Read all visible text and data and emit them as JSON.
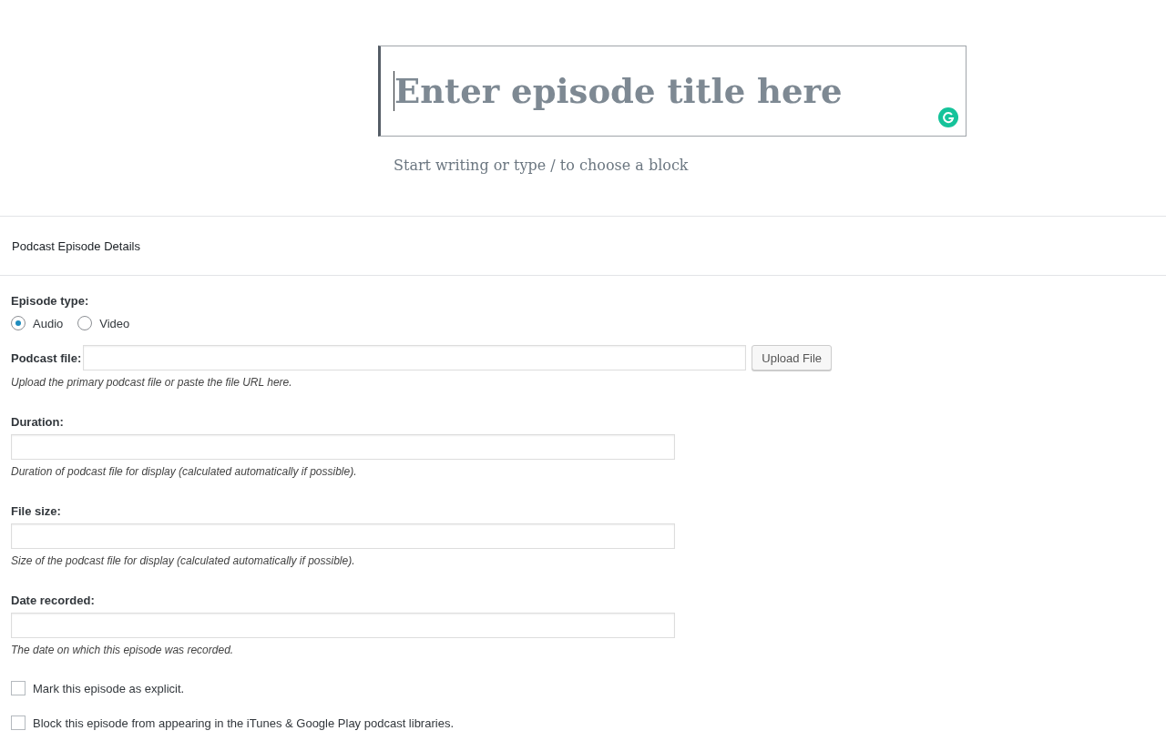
{
  "editor": {
    "title_placeholder": "Enter episode title here",
    "block_hint": "Start writing or type / to choose a block"
  },
  "panel": {
    "title": "Podcast Episode Details",
    "fields": [
      {
        "kind": "radio",
        "label": "Episode type:",
        "options": [
          {
            "label": "Audio",
            "selected": true
          },
          {
            "label": "Video",
            "selected": false
          }
        ]
      },
      {
        "kind": "file",
        "label": "Podcast file:",
        "button": "Upload File",
        "hint": "Upload the primary podcast file or paste the file URL here."
      },
      {
        "kind": "text",
        "label": "Duration:",
        "hint": "Duration of podcast file for display (calculated automatically if possible)."
      },
      {
        "kind": "text",
        "label": "File size:",
        "hint": "Size of the podcast file for display (calculated automatically if possible)."
      },
      {
        "kind": "text",
        "label": "Date recorded:",
        "hint": "The date on which this episode was recorded."
      },
      {
        "kind": "checkbox",
        "label": "Mark this episode as explicit.",
        "checked": false
      },
      {
        "kind": "checkbox",
        "label": "Block this episode from appearing in the iTunes & Google Play podcast libraries.",
        "checked": false
      }
    ]
  }
}
